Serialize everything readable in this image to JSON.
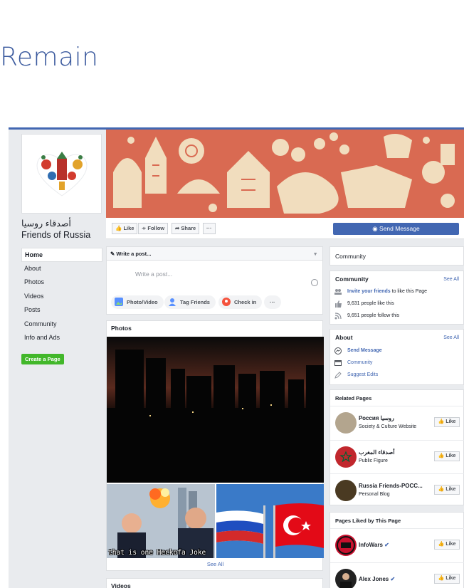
{
  "heading": "Remain",
  "page": {
    "name": "أصدقاء روسيا Friends of Russia"
  },
  "nav": {
    "items": [
      "Home",
      "About",
      "Photos",
      "Videos",
      "Posts",
      "Community",
      "Info and Ads"
    ],
    "create_page": "Create a Page"
  },
  "actions": {
    "like": "Like",
    "follow": "Follow",
    "share": "Share",
    "more": "···",
    "send_message": "Send Message"
  },
  "composer": {
    "header": "Write a post...",
    "placeholder": "Write a post...",
    "photo_video": "Photo/Video",
    "tag_friends": "Tag Friends",
    "check_in": "Check in",
    "more": "···"
  },
  "photos": {
    "title": "Photos",
    "meme_caption": "that is one Heckofa Joke",
    "see_all": "See All"
  },
  "videos": {
    "title": "Videos"
  },
  "community_tab": "Community",
  "community": {
    "title": "Community",
    "see_all": "See All",
    "invite_link": "Invite your friends",
    "invite_rest": " to like this Page",
    "likes": "9,631 people like this",
    "follows": "9,651 people follow this"
  },
  "about": {
    "title": "About",
    "see_all": "See All",
    "send_message": "Send Message",
    "category": "Community",
    "suggest": "Suggest Edits"
  },
  "related": {
    "title": "Related Pages",
    "items": [
      {
        "name": "Россия روسيا",
        "sub": "Society & Culture Website",
        "like": "Like"
      },
      {
        "name": "أصدقاء المغرب",
        "sub": "Public Figure",
        "like": "Like"
      },
      {
        "name": "Russia Friends-РОСС...",
        "sub": "Personal Blog",
        "like": "Like"
      }
    ]
  },
  "liked": {
    "title": "Pages Liked by This Page",
    "items": [
      {
        "name": "InfoWars",
        "like": "Like"
      },
      {
        "name": "Alex Jones",
        "like": "Like"
      }
    ]
  },
  "colors": {
    "brand": "#4267b2",
    "cover": "#d96a52",
    "cover_motif": "#f3e4c4",
    "green": "#42b72a"
  }
}
